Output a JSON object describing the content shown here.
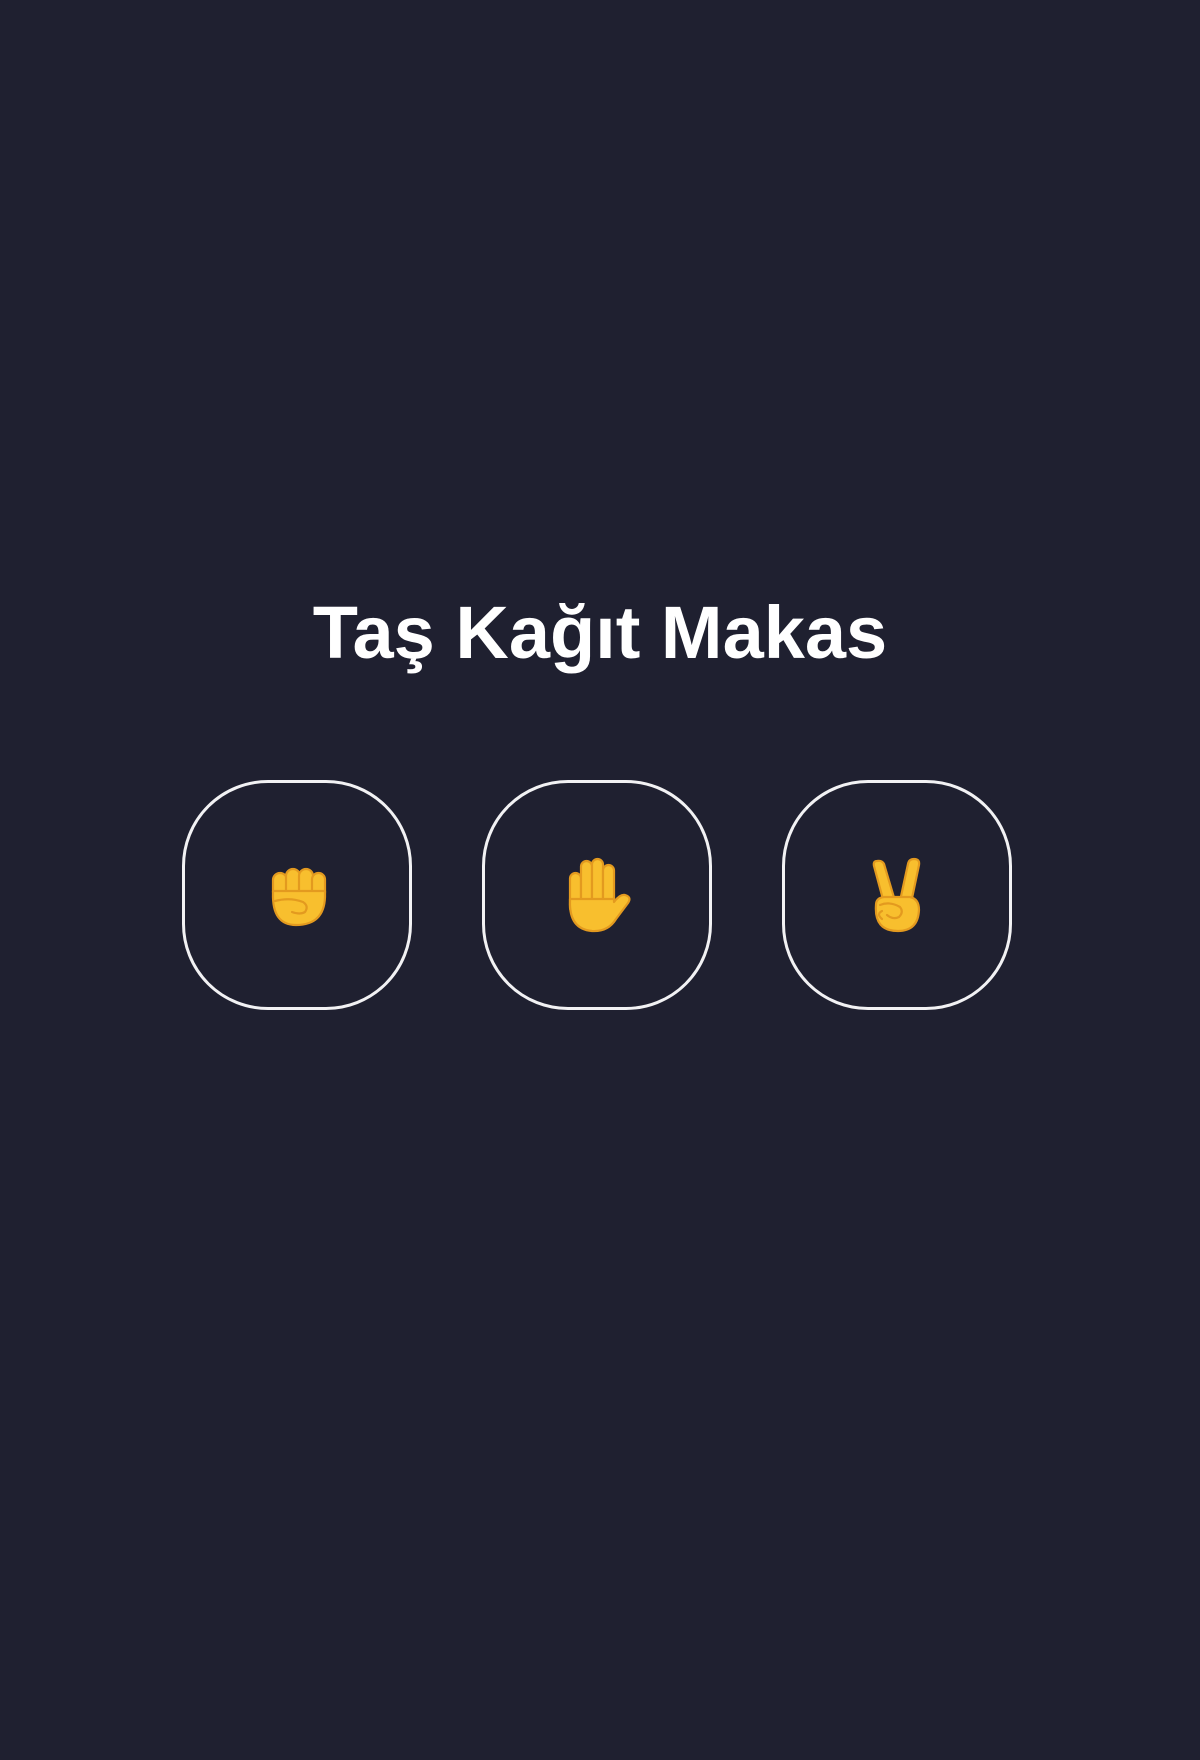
{
  "game": {
    "title": "Taş Kağıt Makas"
  },
  "choices": [
    {
      "name": "rock",
      "icon": "raised-fist-icon"
    },
    {
      "name": "paper",
      "icon": "raised-hand-icon"
    },
    {
      "name": "scissors",
      "icon": "victory-hand-icon"
    }
  ],
  "colors": {
    "background": "#1f2030",
    "title": "#ffffff",
    "button_border": "#f2f2f4",
    "emoji_fill": "#f8bf2e",
    "emoji_stroke": "#e39a1f"
  }
}
